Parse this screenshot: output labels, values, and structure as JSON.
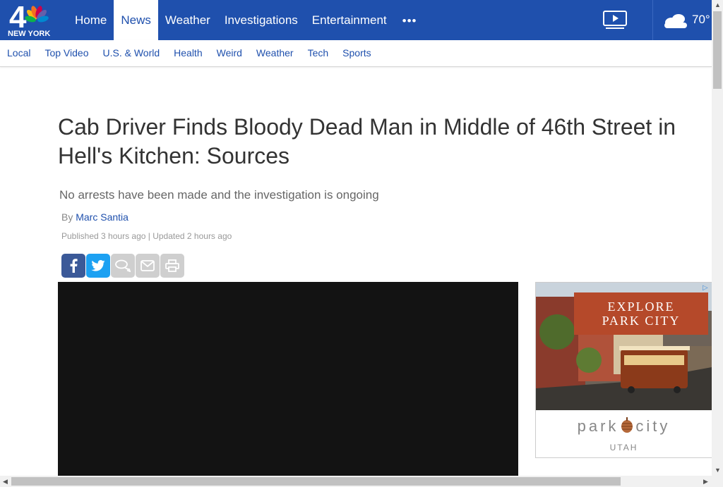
{
  "header": {
    "logo_number": "4",
    "logo_text": "NEW YORK",
    "nav_items": [
      "Home",
      "News",
      "Weather",
      "Investigations",
      "Entertainment"
    ],
    "active_item": "News",
    "more_label": "•••",
    "temperature": "70°",
    "icons": [
      "video-player-icon",
      "cloudy-weather-icon"
    ]
  },
  "subnav": {
    "items": [
      "Local",
      "Top Video",
      "U.S. & World",
      "Health",
      "Weird",
      "Weather",
      "Tech",
      "Sports"
    ]
  },
  "article": {
    "headline": "Cab Driver Finds Bloody Dead Man in Middle of 46th Street in Hell's Kitchen: Sources",
    "subheadline": "No arrests have been made and the investigation is ongoing",
    "by_prefix": "By",
    "author": "Marc Santia",
    "published": "Published 3 hours ago | Updated 2 hours ago",
    "share_icons": [
      "facebook-icon",
      "twitter-icon",
      "comment-icon",
      "email-icon",
      "print-icon"
    ]
  },
  "ad": {
    "banner_line1": "EXPLORE",
    "banner_line2": "PARK CITY",
    "brand_left": "park",
    "brand_right": "city",
    "state": "UTAH"
  },
  "colors": {
    "brand_blue": "#1f50ad",
    "facebook": "#3b5998",
    "twitter": "#1da1f2",
    "ad_banner": "#b5492a"
  }
}
